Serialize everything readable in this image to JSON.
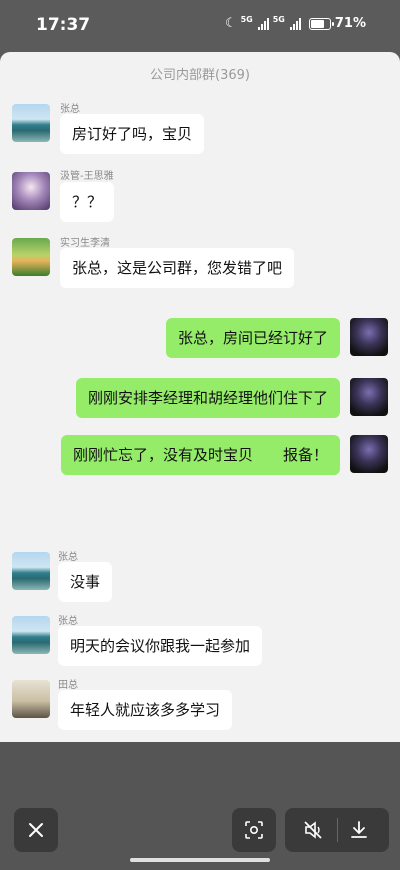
{
  "status": {
    "time": "17:37",
    "net1": "5G",
    "net2": "5G",
    "battery": "71%"
  },
  "chat": {
    "title": "公司内部群(369)",
    "messages": [
      {
        "sender": "张总",
        "text": "房订好了吗，宝贝"
      },
      {
        "sender": "汲管-王思雅",
        "text": "？？"
      },
      {
        "sender": "实习生李清",
        "text": "张总，这是公司群，您发错了吧"
      },
      {
        "text": "张总，房间已经订好了"
      },
      {
        "text": "刚刚安排李经理和胡经理他们住下了"
      },
      {
        "text": "刚刚忙忘了，没有及时宝贝　　报备！"
      },
      {
        "sender": "张总",
        "text": "没事"
      },
      {
        "sender": "张总",
        "text": "明天的会议你跟我一起参加"
      },
      {
        "sender": "田总",
        "text": "年轻人就应该多多学习"
      }
    ]
  },
  "controls": {
    "close_icon": "close-icon",
    "scan_icon": "scan-icon",
    "mute_icon": "mute-icon",
    "download_icon": "download-icon"
  }
}
